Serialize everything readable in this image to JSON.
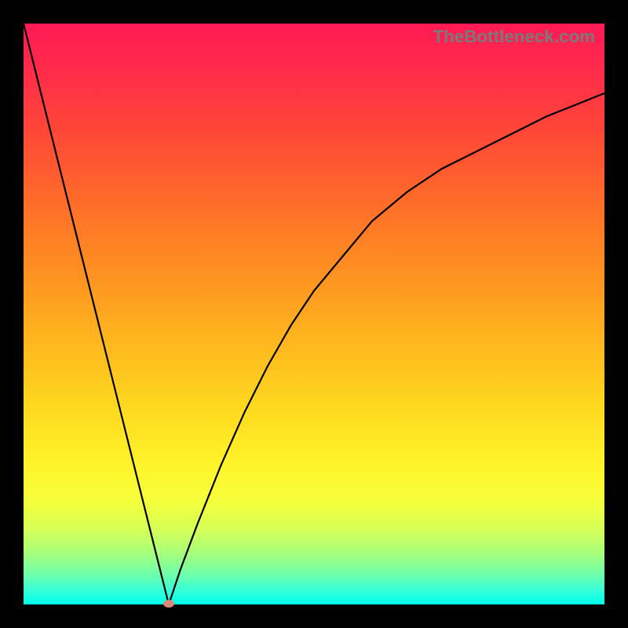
{
  "attribution": "TheBottleneck.com",
  "colors": {
    "frame": "#000000",
    "gradient_top": "#ff1a55",
    "gradient_bottom": "#00ffea",
    "curve": "#000000",
    "min_marker": "#d88a7a"
  },
  "chart_data": {
    "type": "line",
    "title": "",
    "xlabel": "",
    "ylabel": "",
    "xlim": [
      0,
      100
    ],
    "ylim": [
      0,
      100
    ],
    "grid": false,
    "legend": false,
    "description": "V-shaped bottleneck curve on rainbow gradient; minimum (best match) is near x≈25 at y≈0; steep linear left arm, saturating right arm.",
    "series": [
      {
        "name": "bottleneck-curve",
        "x": [
          0,
          2,
          5,
          8,
          12,
          16,
          20,
          23,
          25,
          27,
          30,
          34,
          38,
          42,
          46,
          50,
          55,
          60,
          66,
          72,
          78,
          84,
          90,
          95,
          100
        ],
        "y": [
          100,
          92,
          80,
          68,
          52,
          36,
          20,
          8,
          0,
          6,
          14,
          24,
          33,
          41,
          48,
          54,
          60,
          66,
          71,
          75,
          78,
          81,
          84,
          86,
          88
        ]
      }
    ],
    "min_point": {
      "x": 25,
      "y": 0
    }
  }
}
